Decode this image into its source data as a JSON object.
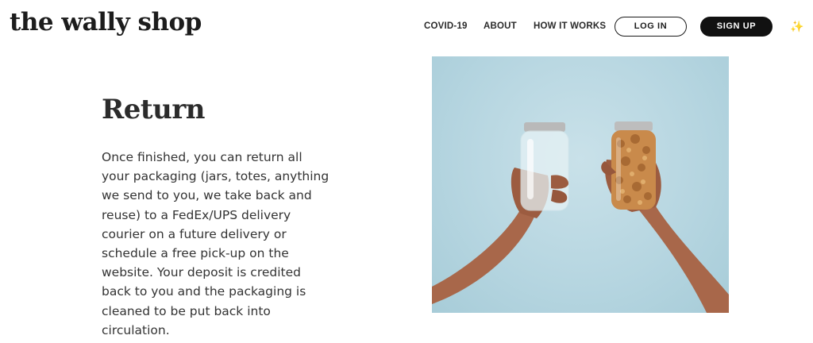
{
  "header": {
    "logo": "the wally shop",
    "nav": [
      {
        "label": "COVID-19"
      },
      {
        "label": "ABOUT"
      },
      {
        "label": "HOW IT WORKS"
      }
    ],
    "login_label": "LOG IN",
    "signup_label": "SIGN UP",
    "sparkle": "✨"
  },
  "main": {
    "title": "Return",
    "body": "Once finished, you can return all your packaging (jars, totes, anything we send to you, we take back and reuse) to a FedEx/UPS delivery courier on a future delivery or schedule a free pick-up on the website. Your deposit is credited back to you and the packaging is cleaned to be put back into circulation."
  },
  "colors": {
    "photo_background": "#b5d5e0",
    "signup_background": "#111111",
    "text": "#333333"
  }
}
